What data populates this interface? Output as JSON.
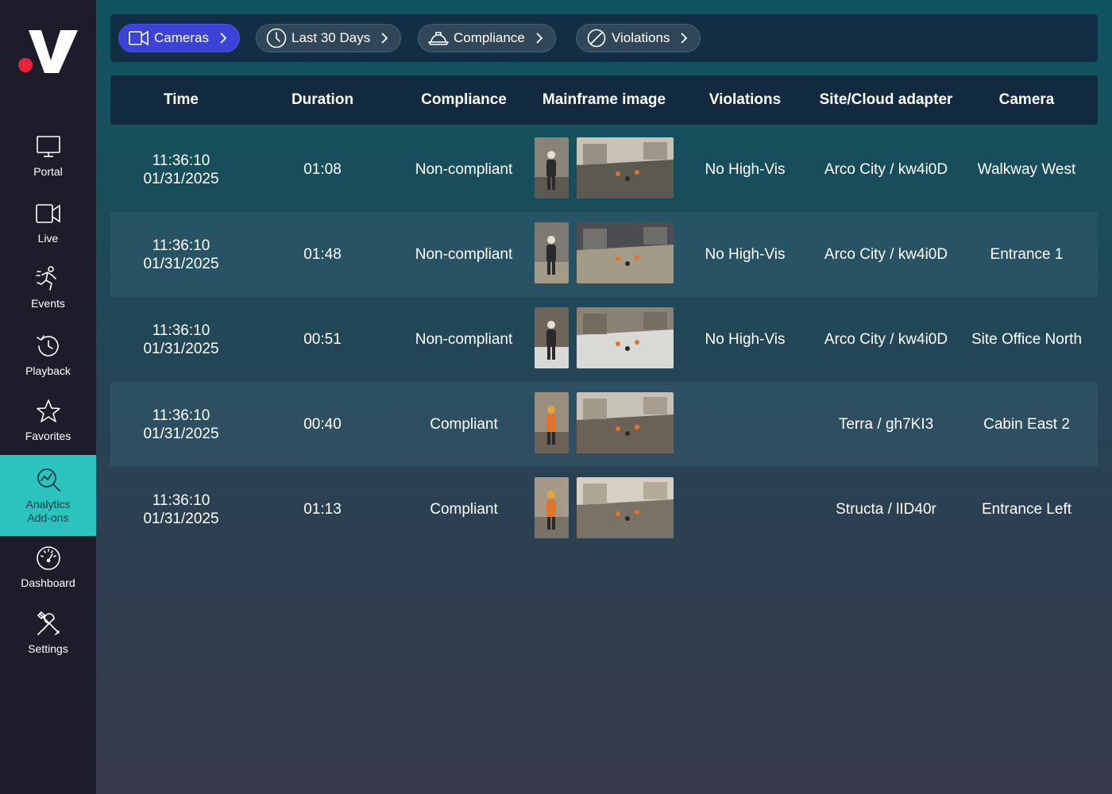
{
  "brand": {
    "logo_letter": "V",
    "accent": "#e8223a"
  },
  "sidebar": {
    "items": [
      {
        "label": "Portal",
        "icon": "monitor-icon"
      },
      {
        "label": "Live",
        "icon": "video-camera-icon"
      },
      {
        "label": "Events",
        "icon": "event-run-icon"
      },
      {
        "label": "Playback",
        "icon": "history-icon"
      },
      {
        "label": "Favorites",
        "icon": "star-icon"
      },
      {
        "label": "Analytics\nAdd-ons",
        "icon": "analytics-search-icon",
        "active": true
      },
      {
        "label": "Dashboard",
        "icon": "gauge-icon"
      },
      {
        "label": "Settings",
        "icon": "tools-icon"
      }
    ],
    "active_color": "#2cc2be"
  },
  "filters": [
    {
      "label": "Cameras",
      "icon": "video-camera-icon",
      "primary": true
    },
    {
      "label": "Last 30 Days",
      "icon": "clock-icon"
    },
    {
      "label": "Compliance",
      "icon": "hard-hat-icon"
    },
    {
      "label": "Violations",
      "icon": "prohibited-icon"
    }
  ],
  "table": {
    "columns": [
      "Time",
      "Duration",
      "Compliance",
      "Mainframe image",
      "Violations",
      "Site/Cloud adapter",
      "Camera"
    ],
    "rows": [
      {
        "time": "11:36:10",
        "date": "01/31/2025",
        "duration": "01:08",
        "compliance": "Non-compliant",
        "violations": "No High-Vis",
        "adapter": "Arco City / kw4i0D",
        "camera": "Walkway West"
      },
      {
        "time": "11:36:10",
        "date": "01/31/2025",
        "duration": "01:48",
        "compliance": "Non-compliant",
        "violations": "No High-Vis",
        "adapter": "Arco City / kw4i0D",
        "camera": "Entrance 1"
      },
      {
        "time": "11:36:10",
        "date": "01/31/2025",
        "duration": "00:51",
        "compliance": "Non-compliant",
        "violations": "No High-Vis",
        "adapter": "Arco City / kw4i0D",
        "camera": "Site Office North"
      },
      {
        "time": "11:36:10",
        "date": "01/31/2025",
        "duration": "00:40",
        "compliance": "Compliant",
        "violations": "",
        "adapter": "Terra / gh7KI3",
        "camera": "Cabin East 2"
      },
      {
        "time": "11:36:10",
        "date": "01/31/2025",
        "duration": "01:13",
        "compliance": "Compliant",
        "violations": "",
        "adapter": "Structa / lID40r",
        "camera": "Entrance Left"
      }
    ]
  }
}
